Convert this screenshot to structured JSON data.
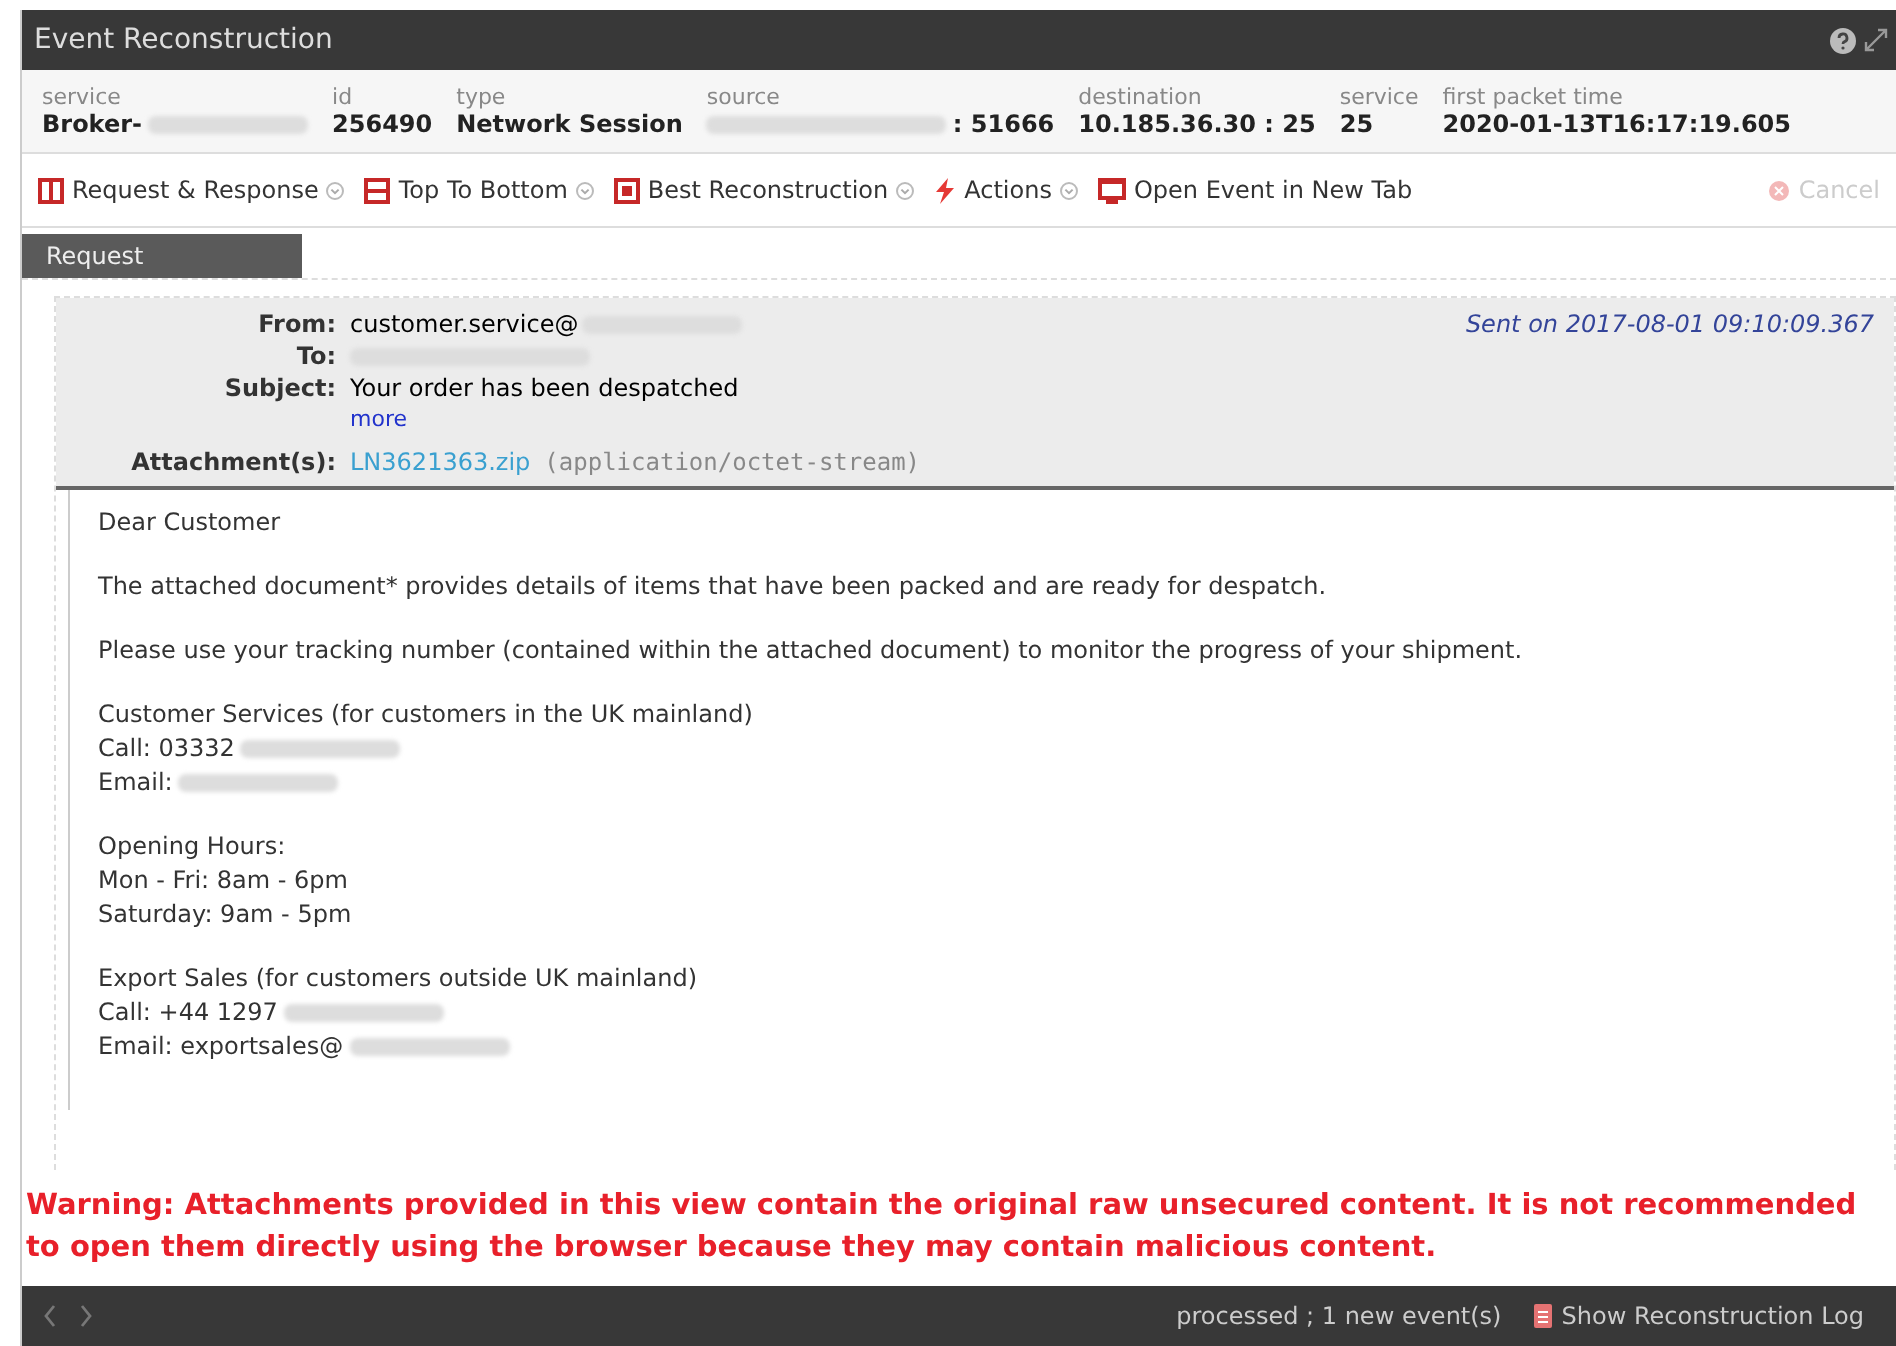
{
  "window": {
    "title": "Event Reconstruction"
  },
  "meta": [
    {
      "label": "service",
      "value": "Broker-",
      "redacted": true
    },
    {
      "label": "id",
      "value": "256490",
      "redacted": false
    },
    {
      "label": "type",
      "value": "Network Session",
      "redacted": false
    },
    {
      "label": "source",
      "value": ": 51666",
      "redacted": true
    },
    {
      "label": "destination",
      "value": "10.185.36.30 : 25",
      "redacted": false
    },
    {
      "label": "service",
      "value": "25",
      "redacted": false
    },
    {
      "label": "first packet time",
      "value": "2020-01-13T16:17:19.605",
      "redacted": false
    }
  ],
  "toolbar": [
    {
      "label": "Request & Response",
      "kind": "split",
      "dropdown": true
    },
    {
      "label": "Top To Bottom",
      "kind": "layout",
      "dropdown": true
    },
    {
      "label": "Best Reconstruction",
      "kind": "view",
      "dropdown": true
    },
    {
      "label": "Actions",
      "kind": "bolt",
      "dropdown": true
    },
    {
      "label": "Open Event in New Tab",
      "kind": "newtab",
      "dropdown": false
    }
  ],
  "cancel": {
    "label": "Cancel",
    "disabled": true
  },
  "tab": {
    "label": "Request"
  },
  "email": {
    "sent": "Sent on 2017-08-01 09:10:09.367",
    "headers": [
      {
        "label": "From:",
        "value": "customer.service@",
        "redacted": true
      },
      {
        "label": "To:",
        "redacted": true
      },
      {
        "label": "Subject:",
        "value": "Your order has been despatched",
        "redacted": false
      }
    ],
    "more": "more",
    "attachment_label": "Attachment(s):",
    "attachment": "LN3621363.zip",
    "attachment_type": "(application/octet-stream)",
    "body": [
      [
        {
          "text": "Dear Customer",
          "redacted": false
        }
      ],
      [
        {
          "text": "The attached document* provides details of items that have been packed and are ready for despatch.",
          "redacted": false
        }
      ],
      [
        {
          "text": "Please use your tracking number (contained within the attached document) to monitor the progress of your shipment.",
          "redacted": false
        }
      ],
      [
        {
          "text": "Customer Services (for customers in the UK mainland)",
          "redacted": false
        },
        {
          "text": "Call: 03332",
          "redacted": true
        },
        {
          "text": "Email:",
          "redacted": true
        }
      ],
      [
        {
          "text": "Opening Hours:",
          "redacted": false
        },
        {
          "text": "Mon - Fri: 8am - 6pm",
          "redacted": false
        },
        {
          "text": "Saturday: 9am - 5pm",
          "redacted": false
        }
      ],
      [
        {
          "text": "Export Sales (for customers outside UK mainland)",
          "redacted": false
        },
        {
          "text": "Call: +44 1297",
          "redacted": true
        },
        {
          "text": "Email: exportsales@",
          "redacted": true
        }
      ]
    ]
  },
  "warning": "Warning: Attachments provided in this view contain the original raw unsecured content. It is not recommended to open them directly using the browser because they may contain malicious content.",
  "status_bar": {
    "status": "processed ; 1 new event(s)",
    "log_button": "Show Reconstruction Log"
  }
}
